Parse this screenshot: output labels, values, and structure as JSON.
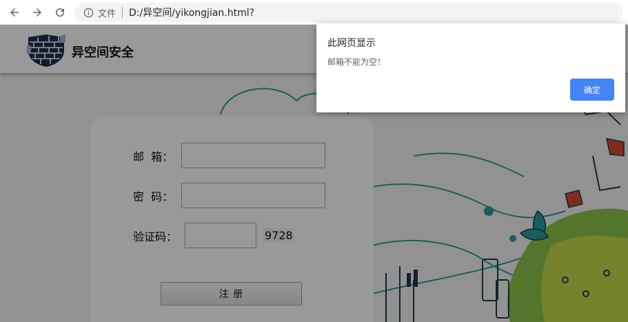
{
  "browser": {
    "back_icon": "arrow-left",
    "forward_icon": "arrow-right",
    "reload_icon": "reload",
    "info_icon": "info-circle",
    "file_label": "文件",
    "url": "D:/异空间/yikongjian.html?"
  },
  "header": {
    "logo_icon": "brick-shield-logo",
    "brand": "异空间安全"
  },
  "form": {
    "email_label": "邮  箱：",
    "email_value": "",
    "password_label": "密  码：",
    "password_value": "",
    "captcha_label": "验证码：",
    "captcha_value": "",
    "captcha_code": "9728",
    "register_label": "注 册"
  },
  "dialog": {
    "title": "此网页显示",
    "message": "邮箱不能为空！",
    "ok_label": "确定"
  },
  "colors": {
    "accent": "#4285f4",
    "overlay": "rgba(0,0,0,0.40)",
    "illustration_green": "#8bc34a",
    "illustration_teal": "#2a9d9a"
  }
}
